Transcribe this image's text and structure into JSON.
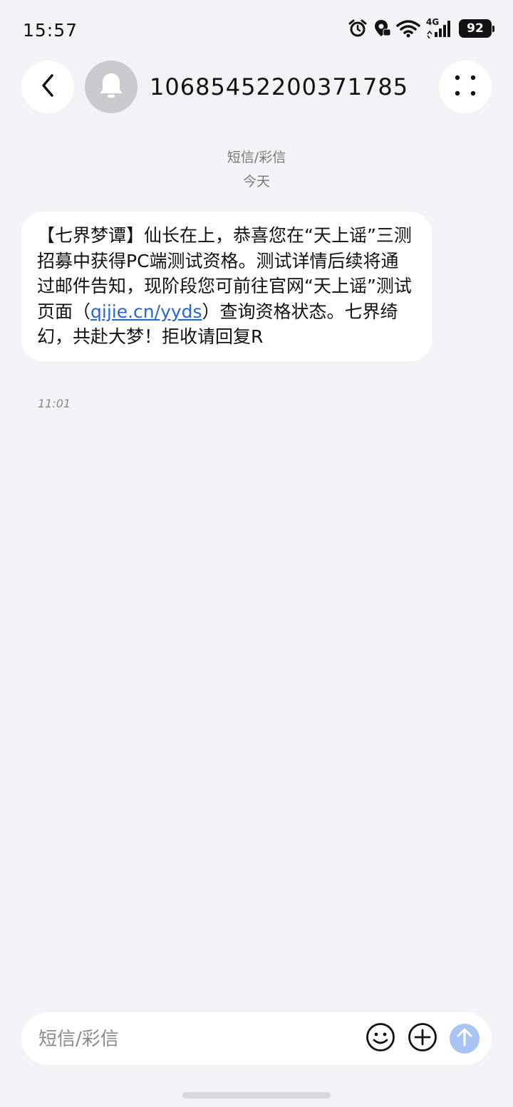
{
  "status_bar": {
    "time": "15:57",
    "battery": "92",
    "network": "4G"
  },
  "header": {
    "contact_number": "10685452200371785"
  },
  "conversation": {
    "type_label": "短信/彩信",
    "date_label": "今天"
  },
  "message": {
    "text_before_link": "【七界梦谭】仙长在上，恭喜您在“天上谣”三测招募中获得PC端测试资格。测试详情后续将通过邮件告知，现阶段您可前往官网“天上谣”测试页面（",
    "link": "qijie.cn/yyds",
    "text_after_link": "）查询资格状态。七界绮幻，共赴大梦！拒收请回复R",
    "time": "11:01"
  },
  "input": {
    "placeholder": "短信/彩信"
  },
  "colors": {
    "background": "#f1f3f6",
    "link": "#2a66cf",
    "send_button": "#a8c4f5"
  }
}
